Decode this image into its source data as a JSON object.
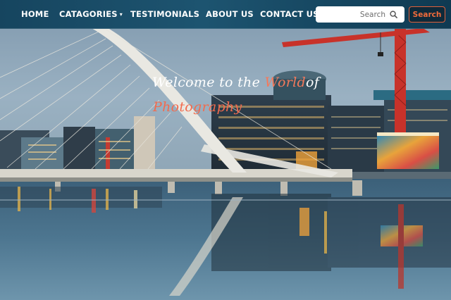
{
  "nav": {
    "items": [
      {
        "label": "HOME"
      },
      {
        "label": "CATAGORIES"
      },
      {
        "label": "TESTIMONIALS"
      },
      {
        "label": "ABOUT US"
      },
      {
        "label": "CONTACT US"
      }
    ],
    "dropdown_caret": "▾"
  },
  "search": {
    "placeholder": "Search",
    "button_label": "Search",
    "icon": "search-icon"
  },
  "hero": {
    "headline_part1": "Welcome to the ",
    "headline_highlight": "World",
    "headline_part2": "of",
    "subheadline": "Photography"
  },
  "colors": {
    "nav_bg": "#1d5470",
    "accent": "#f26b3a",
    "headline_white": "#ffffff",
    "headline_highlight": "#f4795b"
  }
}
